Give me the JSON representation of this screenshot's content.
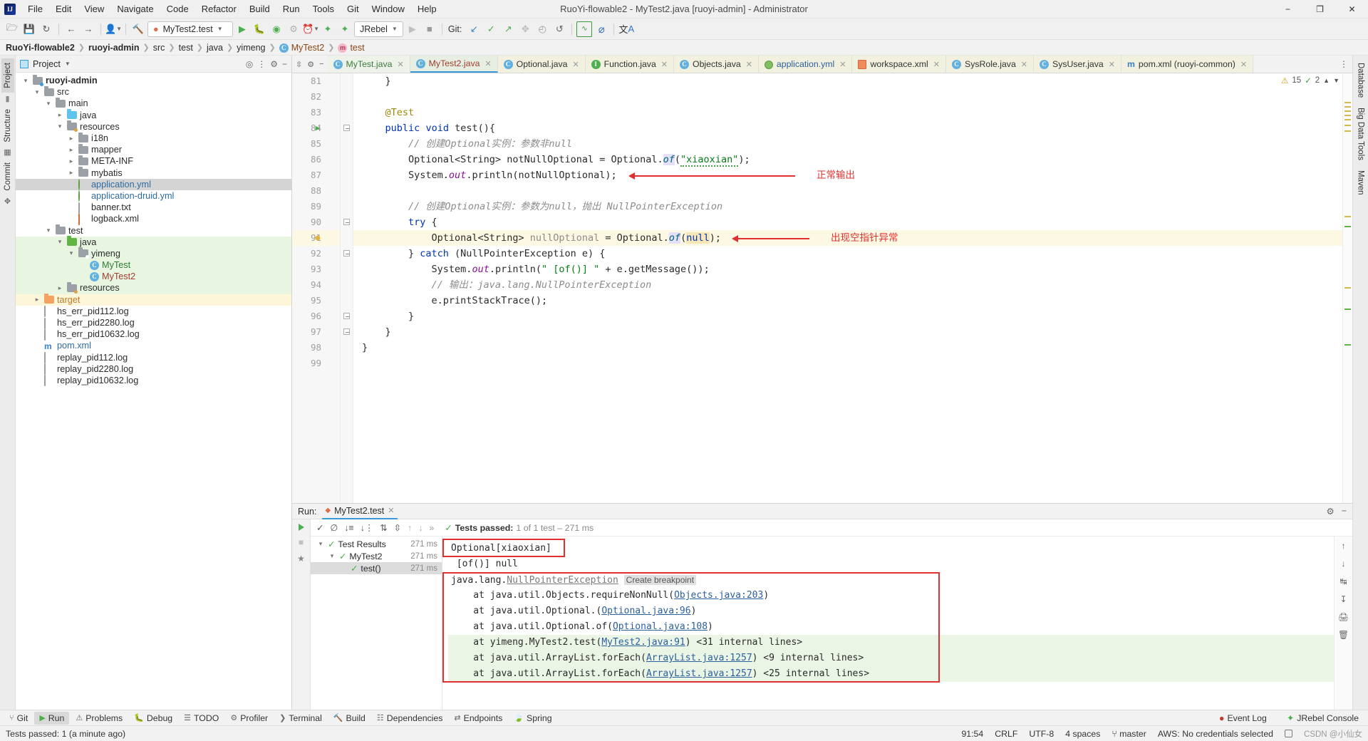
{
  "titlebar": {
    "logo": "IJ",
    "menus": [
      "File",
      "Edit",
      "View",
      "Navigate",
      "Code",
      "Refactor",
      "Build",
      "Run",
      "Tools",
      "Git",
      "Window",
      "Help"
    ],
    "title": "RuoYi-flowable2 - MyTest2.java [ruoyi-admin] - Administrator",
    "minimize": "−",
    "maximize": "❐",
    "close": "✕"
  },
  "toolbar": {
    "open_icon": "open-folder-icon",
    "save_icon": "save-icon",
    "sync_icon": "sync-icon",
    "back_icon": "←",
    "forward_icon": "→",
    "profile_icon": "user-icon",
    "build_icon": "hammer-icon",
    "run_config": "MyTest2.test",
    "run_icon": "▶",
    "debug_icon": "debug-icon",
    "run_coverage_icon": "run-coverage-icon",
    "profiler_icon": "profiler-icon",
    "rerun_icon": "rerun-icon",
    "jrebel_run_icon": "jrebel-run-icon",
    "jrebel_debug_icon": "jrebel-debug-icon",
    "jrebel": "JRebel",
    "stop_icon": "■",
    "git_label": "Git:",
    "git_update_icon": "↙",
    "git_commit_icon": "✓",
    "git_push_icon": "↗",
    "git_branch_icon": "branch-icon",
    "history_icon": "◴",
    "rollback_icon": "↺",
    "search_everywhere_icon": "⌕",
    "settings_icon": "⚙",
    "translate_icon": "translate-icon"
  },
  "breadcrumb": [
    {
      "label": "RuoYi-flowable2",
      "style": "bold"
    },
    {
      "label": "ruoyi-admin",
      "style": "bold"
    },
    {
      "label": "src",
      "style": "plain"
    },
    {
      "label": "test",
      "style": "plain"
    },
    {
      "label": "java",
      "style": "plain"
    },
    {
      "label": "yimeng",
      "style": "plain"
    },
    {
      "label": "MyTest2",
      "style": "class"
    },
    {
      "label": "test",
      "style": "method"
    }
  ],
  "left_strip": [
    "Project",
    "Structure",
    "Commit"
  ],
  "right_strip": [
    "Database",
    "Big Data Tools",
    "Maven"
  ],
  "project": {
    "title": "Project",
    "dropdown_icon": "chevron-down-icon",
    "locate_icon": "crosshair-icon",
    "collapse_icon": "collapse-all-icon",
    "tree": [
      {
        "indent": 0,
        "arrow": "down",
        "icon": "module",
        "label": "ruoyi-admin",
        "style": "bold"
      },
      {
        "indent": 1,
        "arrow": "down",
        "icon": "folder",
        "label": "src",
        "style": "plain"
      },
      {
        "indent": 2,
        "arrow": "down",
        "icon": "folder",
        "label": "main",
        "style": "plain"
      },
      {
        "indent": 3,
        "arrow": "right",
        "icon": "folder-blue",
        "label": "java",
        "style": "plain"
      },
      {
        "indent": 3,
        "arrow": "down",
        "icon": "folder-res",
        "label": "resources",
        "style": "plain"
      },
      {
        "indent": 4,
        "arrow": "right",
        "icon": "folder",
        "label": "i18n",
        "style": "plain"
      },
      {
        "indent": 4,
        "arrow": "right",
        "icon": "folder",
        "label": "mapper",
        "style": "plain"
      },
      {
        "indent": 4,
        "arrow": "right",
        "icon": "folder",
        "label": "META-INF",
        "style": "plain"
      },
      {
        "indent": 4,
        "arrow": "right",
        "icon": "folder",
        "label": "mybatis",
        "style": "plain"
      },
      {
        "indent": 4,
        "arrow": "none",
        "icon": "yml",
        "label": "application.yml",
        "style": "blue",
        "row": "selected"
      },
      {
        "indent": 4,
        "arrow": "none",
        "icon": "yml",
        "label": "application-druid.yml",
        "style": "blue"
      },
      {
        "indent": 4,
        "arrow": "none",
        "icon": "txt",
        "label": "banner.txt",
        "style": "plain"
      },
      {
        "indent": 4,
        "arrow": "none",
        "icon": "xml",
        "label": "logback.xml",
        "style": "plain"
      },
      {
        "indent": 2,
        "arrow": "down",
        "icon": "folder",
        "label": "test",
        "style": "plain"
      },
      {
        "indent": 3,
        "arrow": "down",
        "icon": "folder-green",
        "label": "java",
        "style": "plain",
        "row": "green"
      },
      {
        "indent": 4,
        "arrow": "down",
        "icon": "package",
        "label": "yimeng",
        "style": "plain",
        "row": "green"
      },
      {
        "indent": 5,
        "arrow": "none",
        "icon": "class",
        "label": "MyTest",
        "style": "green",
        "row": "green"
      },
      {
        "indent": 5,
        "arrow": "none",
        "icon": "class",
        "label": "MyTest2",
        "style": "red",
        "row": "green"
      },
      {
        "indent": 3,
        "arrow": "right",
        "icon": "folder-res",
        "label": "resources",
        "style": "plain",
        "row": "green"
      },
      {
        "indent": 1,
        "arrow": "right",
        "icon": "folder-orange",
        "label": "target",
        "style": "orange",
        "row": "yellow"
      },
      {
        "indent": 1,
        "arrow": "none",
        "icon": "log",
        "label": "hs_err_pid112.log",
        "style": "plain"
      },
      {
        "indent": 1,
        "arrow": "none",
        "icon": "log",
        "label": "hs_err_pid2280.log",
        "style": "plain"
      },
      {
        "indent": 1,
        "arrow": "none",
        "icon": "log",
        "label": "hs_err_pid10632.log",
        "style": "plain"
      },
      {
        "indent": 1,
        "arrow": "none",
        "icon": "maven",
        "label": "pom.xml",
        "style": "mvn"
      },
      {
        "indent": 1,
        "arrow": "none",
        "icon": "log",
        "label": "replay_pid112.log",
        "style": "plain"
      },
      {
        "indent": 1,
        "arrow": "none",
        "icon": "log",
        "label": "replay_pid2280.log",
        "style": "plain"
      },
      {
        "indent": 1,
        "arrow": "none",
        "icon": "log",
        "label": "replay_pid10632.log",
        "style": "plain"
      }
    ]
  },
  "editor_tabs": [
    {
      "label": "MyTest.java",
      "icon": "class-test-icon",
      "color": "green",
      "active": false,
      "bg": "green"
    },
    {
      "label": "MyTest2.java",
      "icon": "class-test-icon",
      "color": "red",
      "active": true,
      "bg": "green"
    },
    {
      "label": "Optional.java",
      "icon": "class-lib-icon",
      "color": "dark",
      "active": false,
      "bg": "yellow"
    },
    {
      "label": "Function.java",
      "icon": "interface-icon",
      "color": "dark",
      "active": false,
      "bg": "yellow"
    },
    {
      "label": "Objects.java",
      "icon": "class-lib-icon",
      "color": "dark",
      "active": false,
      "bg": "yellow"
    },
    {
      "label": "application.yml",
      "icon": "yml-icon",
      "color": "blue",
      "active": false,
      "bg": "yellow"
    },
    {
      "label": "workspace.xml",
      "icon": "xml-icon",
      "color": "dark",
      "active": false,
      "bg": "yellow"
    },
    {
      "label": "SysRole.java",
      "icon": "class-lib-icon",
      "color": "dark",
      "active": false,
      "bg": "yellow"
    },
    {
      "label": "SysUser.java",
      "icon": "class-lib-icon",
      "color": "dark",
      "active": false,
      "bg": "yellow"
    },
    {
      "label": "pom.xml (ruoyi-common)",
      "icon": "maven-icon",
      "color": "dark",
      "active": false,
      "bg": "yellow"
    }
  ],
  "inspection_status": {
    "warnings": "15",
    "checks": "2"
  },
  "code": {
    "first_line": 81,
    "lines": [
      {
        "n": 81,
        "html": "    }"
      },
      {
        "n": 82,
        "html": ""
      },
      {
        "n": 83,
        "html": "    <span class=\"anno\">@Test</span>"
      },
      {
        "n": 84,
        "html": "    <span class=\"kw\">public</span> <span class=\"kw\">void</span> test(){"
      },
      {
        "n": 85,
        "html": "        <span class=\"cmt\">// 创建Optional实例：参数非null</span>"
      },
      {
        "n": 86,
        "html": "        Optional&lt;String&gt; notNullOptional = Optional.<span class=\"mth-hl\">of</span>(<span class=\"str sq-underline\">\"xiaoxian\"</span>);"
      },
      {
        "n": 87,
        "html": "        System.<span class=\"fld\">out</span>.println(notNullOptional);"
      },
      {
        "n": 88,
        "html": ""
      },
      {
        "n": 89,
        "html": "        <span class=\"cmt\">// 创建Optional实例：参数为null，抛出 NullPointerException</span>"
      },
      {
        "n": 90,
        "html": "        <span class=\"kw\">try</span> {"
      },
      {
        "n": 91,
        "html": "            Optional&lt;String&gt; <span class=\"grey-var\">nullOptional</span> = Optional.<span class=\"mth-hl\">of</span>(<span class=\"null-hl kw\">null</span>);",
        "highlight": true
      },
      {
        "n": 92,
        "html": "        } <span class=\"kw\">catch</span> (NullPointerException e) {"
      },
      {
        "n": 93,
        "html": "            System.<span class=\"fld\">out</span>.println(<span class=\"str\">\" [of()] \"</span> + e.getMessage());"
      },
      {
        "n": 94,
        "html": "            <span class=\"cmt\">// 输出：java.lang.NullPointerException</span>"
      },
      {
        "n": 95,
        "html": "            e.printStackTrace();"
      },
      {
        "n": 96,
        "html": "        }"
      },
      {
        "n": 97,
        "html": "    }"
      },
      {
        "n": 98,
        "html": "}"
      },
      {
        "n": 99,
        "html": ""
      }
    ],
    "annotations": [
      {
        "text": "正常输出",
        "line": 87
      },
      {
        "text": "出现空指针异常",
        "line": 91
      }
    ]
  },
  "run": {
    "label": "Run:",
    "tab": "MyTest2.test",
    "close_icon": "✕",
    "settings_icon": "⚙",
    "hide_icon": "−",
    "toolbar_icons": [
      "rerun-icon",
      "toggle-passed-icon",
      "ignore-icon",
      "sort-alpha-icon",
      "sort-duration-icon",
      "expand-all-icon",
      "collapse-all-icon",
      "prev-fail-icon",
      "next-fail-icon",
      "more-icon"
    ],
    "status_prefix": "Tests passed:",
    "status_detail": "1 of 1 test – 271 ms",
    "tree": [
      {
        "indent": 0,
        "arrow": "down",
        "label": "Test Results",
        "time": "271 ms"
      },
      {
        "indent": 1,
        "arrow": "down",
        "label": "MyTest2",
        "time": "271 ms"
      },
      {
        "indent": 2,
        "arrow": "none",
        "label": "test()",
        "time": "271 ms",
        "selected": true
      }
    ],
    "console": [
      {
        "text": "Optional[xiaoxian]",
        "type": "boxed"
      },
      {
        "text": " [of()] null",
        "type": "plain"
      },
      {
        "type": "exception",
        "prefix": "java.lang.",
        "link": "NullPointerException",
        "chip": "Create breakpoint"
      },
      {
        "type": "stack",
        "pre": "    at java.util.Objects.requireNonNull(",
        "link": "Objects.java:203",
        "post": ")"
      },
      {
        "type": "stack",
        "pre": "    at java.util.Optional.<init>(",
        "link": "Optional.java:96",
        "post": ")"
      },
      {
        "type": "stack",
        "pre": "    at java.util.Optional.of(",
        "link": "Optional.java:108",
        "post": ")"
      },
      {
        "type": "stack",
        "pre": "    at yimeng.MyTest2.test(",
        "link": "MyTest2.java:91",
        "post": ")",
        "tail": " <31 internal lines>",
        "green": true
      },
      {
        "type": "stack",
        "pre": "    at java.util.ArrayList.forEach(",
        "link": "ArrayList.java:1257",
        "post": ")",
        "tail": " <9 internal lines>",
        "green": true
      },
      {
        "type": "stack",
        "pre": "    at java.util.ArrayList.forEach(",
        "link": "ArrayList.java:1257",
        "post": ")",
        "tail": " <25 internal lines>",
        "green": true
      }
    ],
    "side_icons": [
      "scroll-up-icon",
      "scroll-down-icon",
      "soft-wrap-icon",
      "scroll-end-icon",
      "print-icon",
      "trash-icon"
    ]
  },
  "toolwindow_bar": {
    "items": [
      {
        "label": "Git",
        "icon": "git-icon"
      },
      {
        "label": "Run",
        "icon": "run-icon",
        "selected": true
      },
      {
        "label": "Problems",
        "icon": "problems-icon"
      },
      {
        "label": "Debug",
        "icon": "debug-icon"
      },
      {
        "label": "TODO",
        "icon": "todo-icon"
      },
      {
        "label": "Profiler",
        "icon": "profiler-icon"
      },
      {
        "label": "Terminal",
        "icon": "terminal-icon"
      },
      {
        "label": "Build",
        "icon": "build-icon"
      },
      {
        "label": "Dependencies",
        "icon": "dependencies-icon"
      },
      {
        "label": "Endpoints",
        "icon": "endpoints-icon"
      },
      {
        "label": "Spring",
        "icon": "spring-icon"
      }
    ],
    "right": [
      {
        "label": "Event Log",
        "icon": "event-log-icon"
      },
      {
        "label": "JRebel Console",
        "icon": "jrebel-icon"
      }
    ]
  },
  "statusbar": {
    "left": "Tests passed: 1 (a minute ago)",
    "caret": "91:54",
    "line_sep": "CRLF",
    "encoding": "UTF-8",
    "indent": "4 spaces",
    "branch": "master",
    "aws": "AWS: No credentials selected",
    "lock_icon": "lock-icon",
    "watermark": "CSDN @小仙女"
  }
}
